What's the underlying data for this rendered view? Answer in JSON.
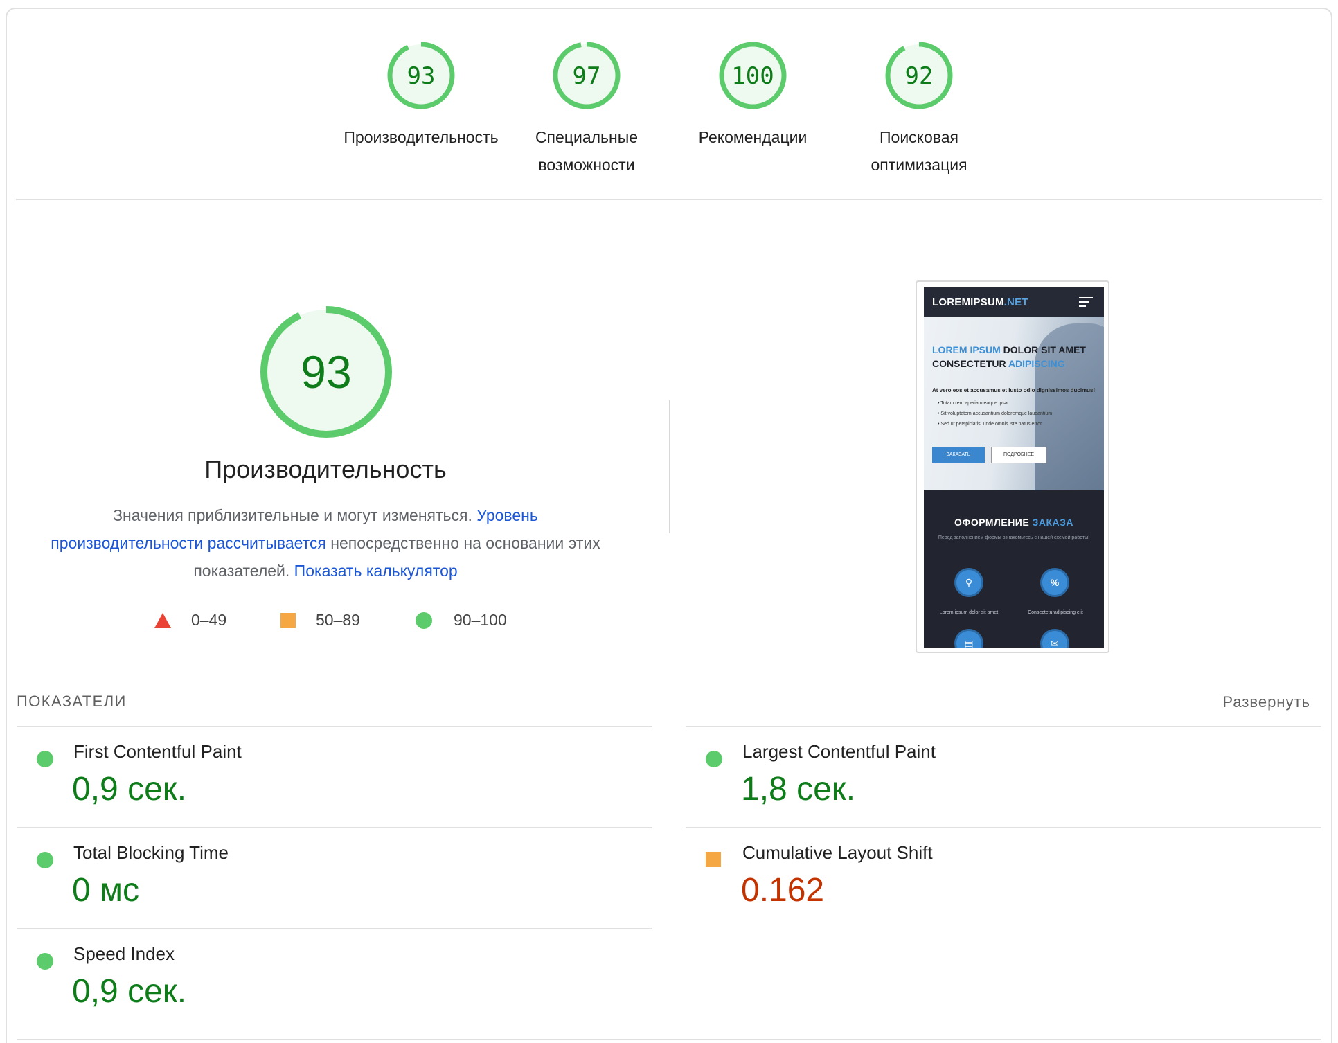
{
  "categories": [
    {
      "score": "93",
      "label_line1": "Производительность",
      "label_line2": "",
      "fill": 0.93
    },
    {
      "score": "97",
      "label_line1": "Специальные",
      "label_line2": "возможности",
      "fill": 0.97
    },
    {
      "score": "100",
      "label_line1": "Рекомендации",
      "label_line2": "",
      "fill": 1.0
    },
    {
      "score": "92",
      "label_line1": "Поисковая",
      "label_line2": "оптимизация",
      "fill": 0.92
    }
  ],
  "performance": {
    "score": "93",
    "fill": 0.93,
    "title": "Производительность",
    "desc_part1": "Значения приблизительные и могут изменяться. ",
    "desc_link1": "Уровень производительности рассчитывается",
    "desc_part2": " непосредственно на основании этих показателей. ",
    "desc_link2": "Показать калькулятор"
  },
  "legend": [
    {
      "icon": "red-triangle-icon",
      "range": "0–49",
      "color": "#ea4335"
    },
    {
      "icon": "orange-square-icon",
      "range": "50–89",
      "color": "#f4a742"
    },
    {
      "icon": "green-circle-icon",
      "range": "90–100",
      "color": "#5ccb6b"
    }
  ],
  "preview": {
    "logo_main": "LOREMIPSUM",
    "logo_accent": ".NET",
    "hero_line1_accent": "LOREM IPSUM",
    "hero_line1_rest": " DOLOR SIT AMET",
    "hero_line2_rest": "CONSECTETUR ",
    "hero_line2_accent": "ADIPISCING",
    "hero_lead": "At vero eos et accusamus et iusto odio dignissimos ducimus!",
    "bullets": [
      "Totam rem aperiam eaque ipsa",
      "Sit voluptatem accusantium doloremque laudantium",
      "Sed ut perspiciatis, unde omnis iste natus error"
    ],
    "btn_primary": "ЗАКАЗАТЬ",
    "btn_secondary": "ПОДРОБНЕЕ",
    "section_title_main": "ОФОРМЛЕНИЕ ",
    "section_title_accent": "ЗАКАЗА",
    "section_sub": "Перед заполнением формы ознакомьтесь с нашей схемой работы!",
    "feature1": "Lorem ipsum dolor sit amet",
    "feature2": "Consecteturadipiscing elit"
  },
  "metrics_header": "ПОКАЗАТЕЛИ",
  "expand_label": "Развернуть",
  "metrics": [
    {
      "name": "First Contentful Paint",
      "value": "0,9 сек.",
      "status": "good"
    },
    {
      "name": "Largest Contentful Paint",
      "value": "1,8 сек.",
      "status": "good"
    },
    {
      "name": "Total Blocking Time",
      "value": "0 мс",
      "status": "good"
    },
    {
      "name": "Cumulative Layout Shift",
      "value": "0.162",
      "status": "average"
    },
    {
      "name": "Speed Index",
      "value": "0,9 сек.",
      "status": "good"
    }
  ],
  "colors": {
    "good": "#0d7c19",
    "good_ring": "#5ccb6b",
    "good_bg": "#eef9ef",
    "average": "#c33300",
    "link": "#1a56d6"
  }
}
